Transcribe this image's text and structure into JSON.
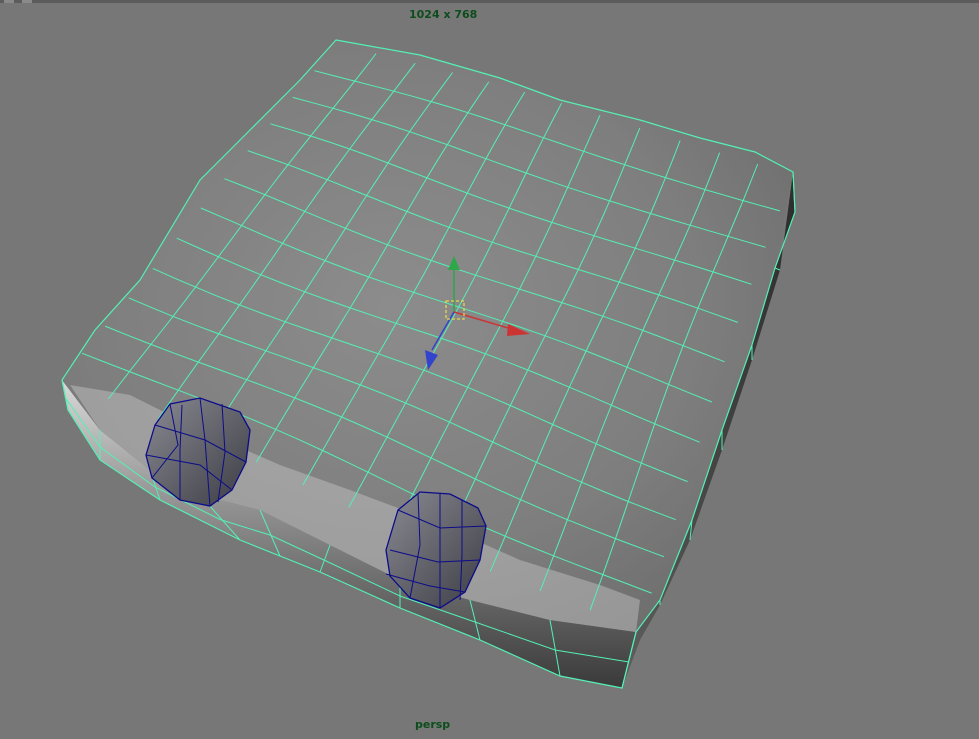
{
  "viewport": {
    "resolution_gate": "1024 x 768",
    "camera_name": "persp"
  },
  "colors": {
    "viewport_bg": "#777777",
    "wireframe_selected": "#54f0b4",
    "wireframe_unselected": "#0c0c8a",
    "axis_x": "#cc3333",
    "axis_y": "#2ea64a",
    "axis_z": "#3344cc",
    "pivot": "#e8d84a",
    "hud_text": "#0d4d1c"
  },
  "icons": {
    "manipulator": "move-manipulator-icon",
    "pivot": "pivot-square-icon"
  }
}
